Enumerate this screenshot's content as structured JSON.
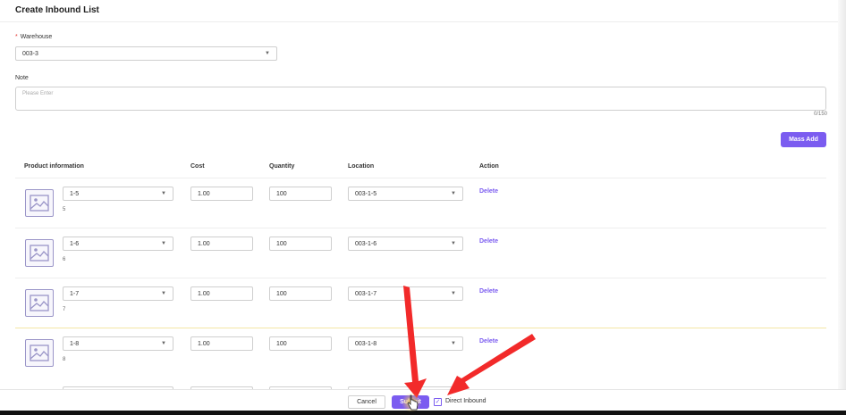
{
  "page": {
    "title": "Create Inbound List"
  },
  "form": {
    "warehouse_required": "*",
    "warehouse_label": "Warehouse",
    "warehouse_value": "003-3",
    "note_label": "Note",
    "note_placeholder": "Please Enter",
    "note_counter": "0/150"
  },
  "toolbar": {
    "mass_add_label": "Mass Add"
  },
  "table": {
    "headers": {
      "product": "Product information",
      "cost": "Cost",
      "quantity": "Quantity",
      "location": "Location",
      "action": "Action"
    },
    "rows": [
      {
        "product": "1-5",
        "sub": "5",
        "cost": "1.00",
        "quantity": "100",
        "location": "003-1-5",
        "action": "Delete"
      },
      {
        "product": "1-6",
        "sub": "6",
        "cost": "1.00",
        "quantity": "100",
        "location": "003-1-6",
        "action": "Delete"
      },
      {
        "product": "1-7",
        "sub": "7",
        "cost": "1.00",
        "quantity": "100",
        "location": "003-1-7",
        "action": "Delete"
      },
      {
        "product": "1-8",
        "sub": "8",
        "cost": "1.00",
        "quantity": "100",
        "location": "003-1-8",
        "action": "Delete"
      }
    ]
  },
  "footer": {
    "cancel_label": "Cancel",
    "submit_label": "Submit",
    "direct_inbound_label": "Direct Inbound",
    "direct_inbound_checked": true
  },
  "icons": {
    "dropdown": "chevron-down-icon",
    "product_image": "image-placeholder-icon",
    "checkbox": "checkmark-icon",
    "cursor": "hand-pointer-icon"
  },
  "colors": {
    "accent": "#7b5cf0",
    "required": "#e53935",
    "annotation_arrow": "#f22a2a",
    "cursor_highlight": "#ffd54f"
  }
}
